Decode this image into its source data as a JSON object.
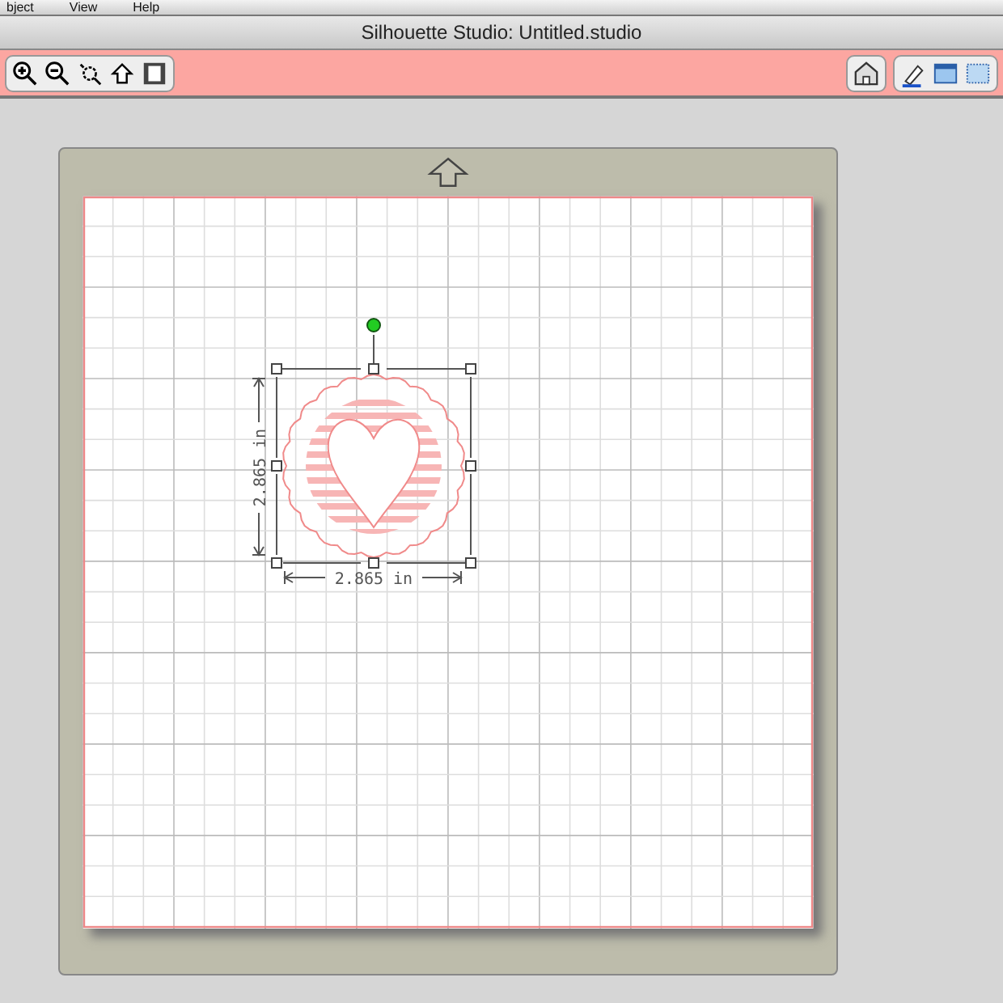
{
  "menu": [
    {
      "label": "bject"
    },
    {
      "label": "View"
    },
    {
      "label": "Help"
    }
  ],
  "window": {
    "title": "Silhouette Studio: Untitled.studio"
  },
  "design": {
    "width_label": "2.865 in",
    "height_label": "2.865 in"
  }
}
